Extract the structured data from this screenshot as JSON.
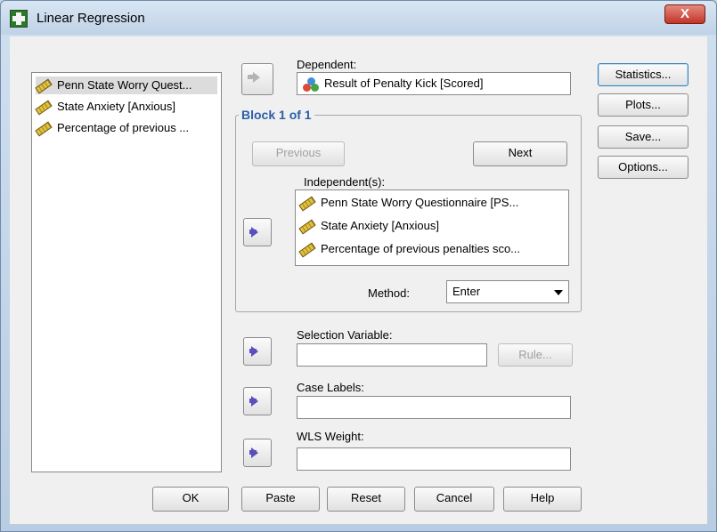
{
  "window": {
    "title": "Linear Regression",
    "close_glyph": "X"
  },
  "variables": [
    {
      "label": "Penn State Worry Quest...",
      "icon": "scale-ruler-icon",
      "selected": true
    },
    {
      "label": "State Anxiety [Anxious]",
      "icon": "scale-ruler-icon",
      "selected": false
    },
    {
      "label": "Percentage of previous ...",
      "icon": "scale-ruler-icon",
      "selected": false
    }
  ],
  "dependent": {
    "label": "Dependent:",
    "value": "Result of Penalty Kick [Scored]",
    "icon": "nominal-icon"
  },
  "block": {
    "title": "Block 1 of 1",
    "previous": "Previous",
    "next": "Next"
  },
  "independents": {
    "label": "Independent(s):",
    "items": [
      "Penn State Worry Questionnaire [PS...",
      "State Anxiety [Anxious]",
      "Percentage of previous penalties sco..."
    ]
  },
  "method": {
    "label": "Method:",
    "value": "Enter"
  },
  "selection": {
    "label": "Selection Variable:",
    "rule": "Rule..."
  },
  "case_labels": {
    "label": "Case Labels:"
  },
  "wls": {
    "label": "WLS Weight:"
  },
  "side_buttons": [
    "Statistics...",
    "Plots...",
    "Save...",
    "Options..."
  ],
  "bottom_buttons": [
    "OK",
    "Paste",
    "Reset",
    "Cancel",
    "Help"
  ]
}
